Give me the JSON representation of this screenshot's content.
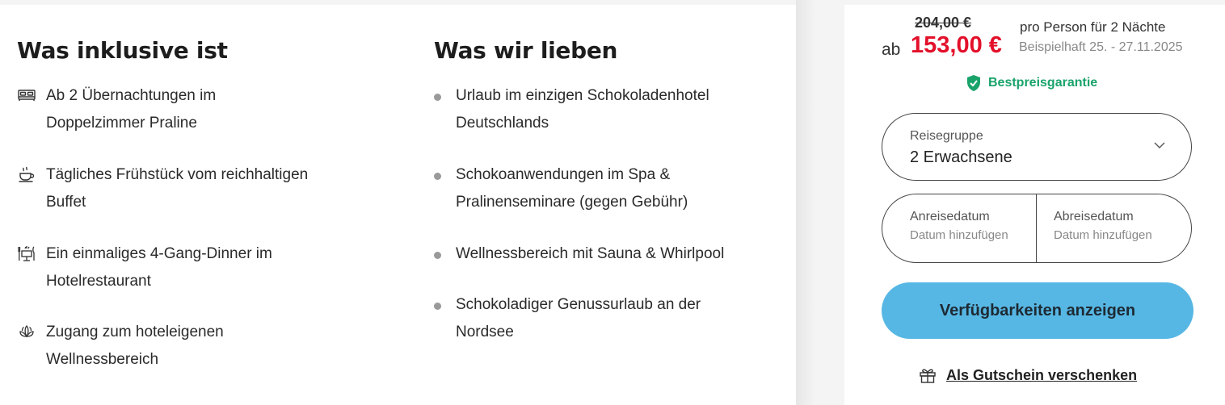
{
  "inclusive": {
    "title": "Was inklusive ist",
    "items": [
      {
        "icon": "bed-icon",
        "line1": "Ab 2 Übernachtungen im",
        "line2": "Doppelzimmer Praline"
      },
      {
        "icon": "coffee-cup-icon",
        "line1": "Tägliches Frühstück vom reichhaltigen",
        "line2": "Buffet"
      },
      {
        "icon": "dinner-icon",
        "line1": "Ein einmaliges 4-Gang-Dinner im",
        "line2": "Hotelrestaurant"
      },
      {
        "icon": "lotus-icon",
        "line1": "Zugang zum hoteleigenen",
        "line2": "Wellnessbereich"
      }
    ]
  },
  "highlights": {
    "title": "Was wir lieben",
    "items": [
      {
        "line1": "Urlaub im einzigen Schokoladenhotel",
        "line2": "Deutschlands"
      },
      {
        "line1": "Schokoanwendungen im Spa &",
        "line2": "Pralinenseminare (gegen Gebühr)"
      },
      {
        "line1": "Wellnessbereich mit Sauna & Whirlpool",
        "line2": ""
      },
      {
        "line1": "Schokoladiger Genussurlaub an der",
        "line2": "Nordsee"
      }
    ]
  },
  "booking": {
    "old_price": "204,00 €",
    "prefix": "ab",
    "price": "153,00 €",
    "per_person": "pro Person für 2 Nächte",
    "example_date": "Beispielhaft 25. - 27.11.2025",
    "best_price": "Bestpreisgarantie",
    "group_label": "Reisegruppe",
    "group_value": "2 Erwachsene",
    "arrival_label": "Anreisedatum",
    "arrival_placeholder": "Datum hinzufügen",
    "departure_label": "Abreisedatum",
    "departure_placeholder": "Datum hinzufügen",
    "cta": "Verfügbarkeiten anzeigen",
    "voucher": "Als Gutschein verschenken"
  },
  "colors": {
    "price_red": "#e3102a",
    "best_price_green": "#19a36a",
    "cta_blue": "#57b7e4"
  }
}
